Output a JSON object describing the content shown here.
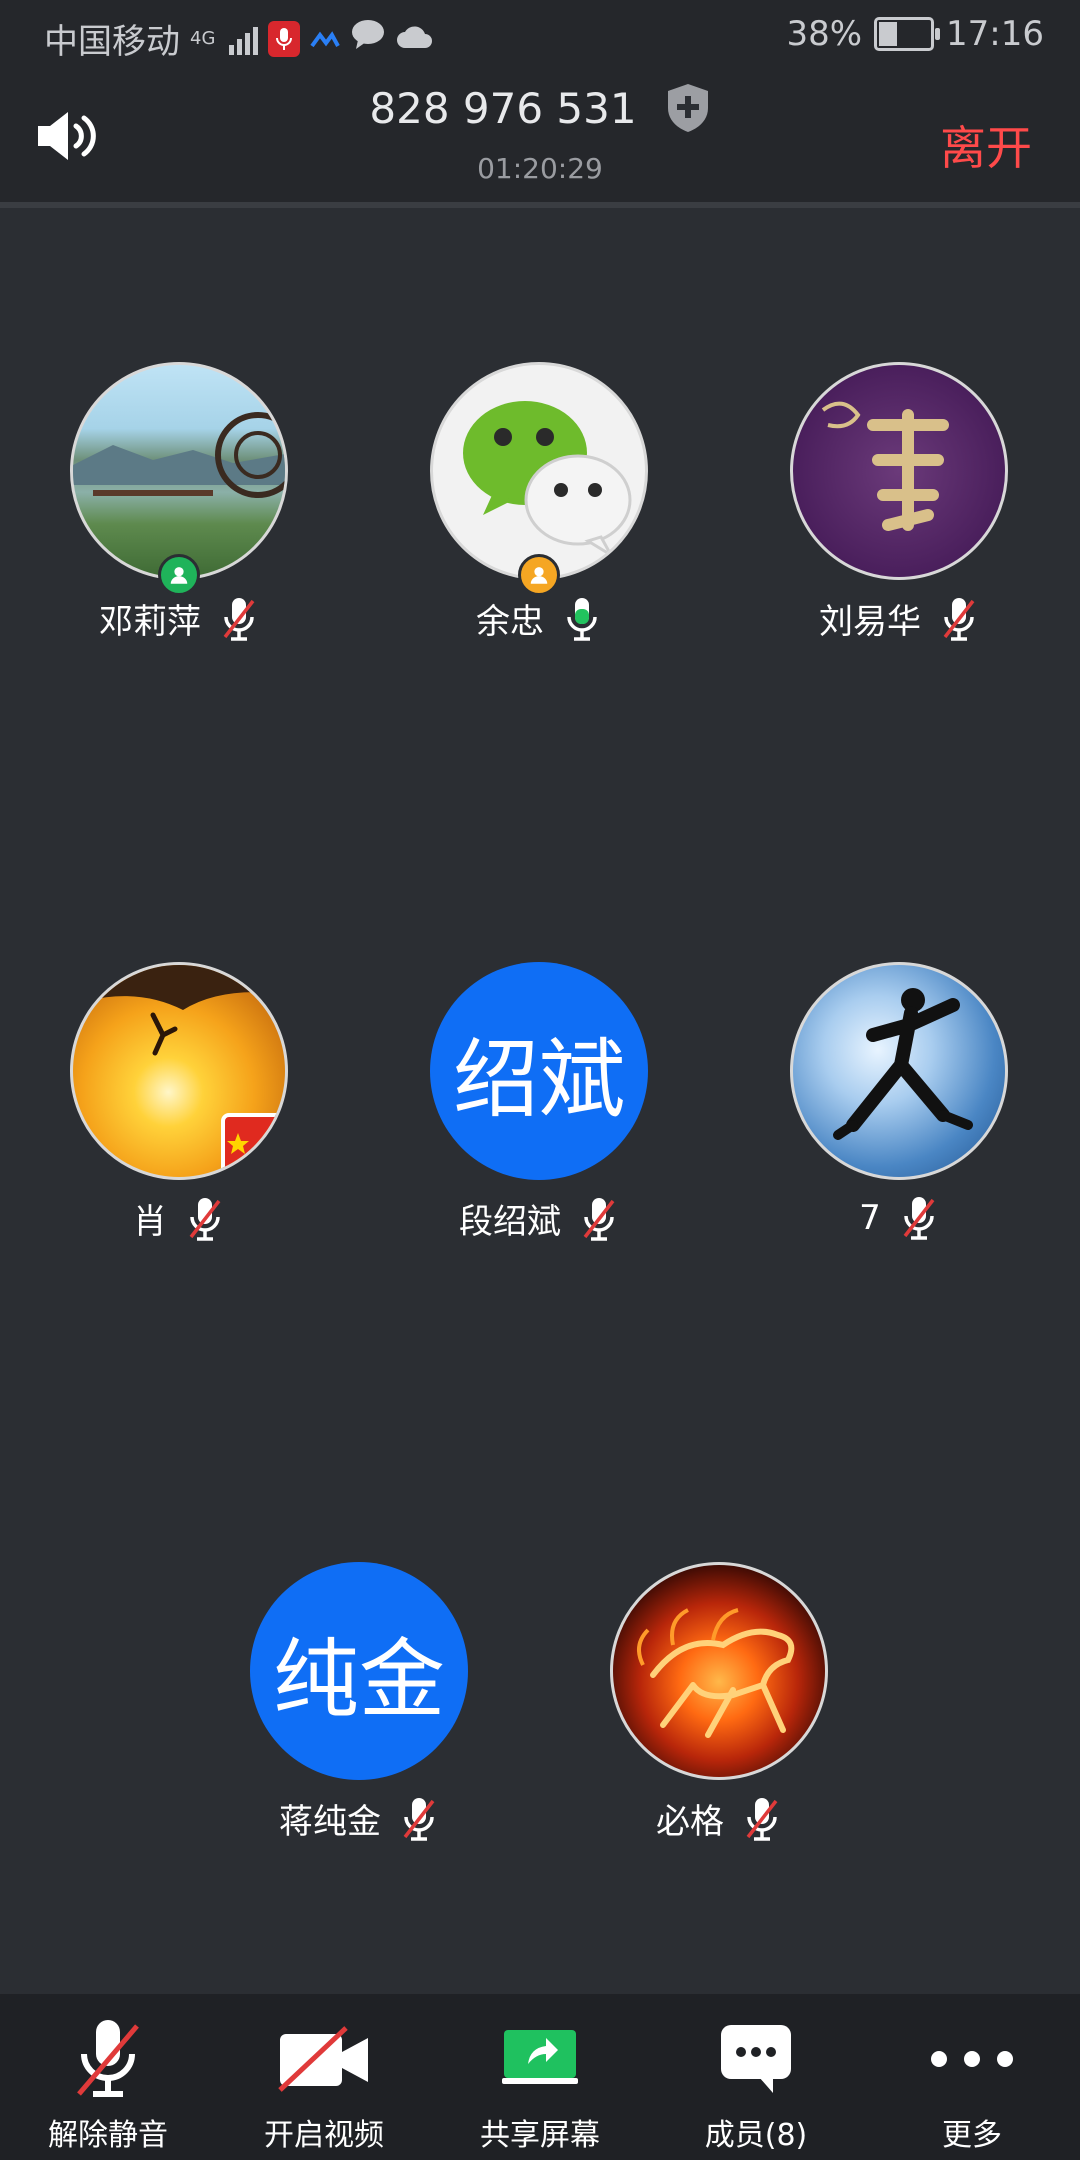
{
  "status_bar": {
    "carrier": "中国移动",
    "network": "4G",
    "battery": "38%",
    "battery_level": 0.38,
    "time": "17:16"
  },
  "header": {
    "meeting_id": "828 976 531",
    "duration": "01:20:29",
    "leave_label": "离开"
  },
  "participants": [
    {
      "name": "邓莉萍",
      "avatar": "photo-landscape",
      "badge": "user-green",
      "mic": "muted"
    },
    {
      "name": "余忠",
      "avatar": "wechat-logo",
      "badge": "user-orange",
      "mic": "active"
    },
    {
      "name": "刘易华",
      "avatar": "purple-calligraphy",
      "mic": "muted"
    },
    {
      "name": "肖",
      "avatar": "photo-sunset",
      "mic": "muted"
    },
    {
      "name": "段绍斌",
      "initials": "绍斌",
      "mic": "muted"
    },
    {
      "name": "7",
      "avatar": "photo-jumpman",
      "mic": "muted"
    },
    {
      "name": "蒋纯金",
      "initials": "纯金",
      "mic": "muted"
    },
    {
      "name": "必格",
      "avatar": "photo-fire-horse",
      "mic": "muted"
    }
  ],
  "toolbar": {
    "unmute": "解除静音",
    "video": "开启视频",
    "share": "共享屏幕",
    "members": "成员(8)",
    "more": "更多"
  },
  "colors": {
    "background": "#2b2e33",
    "leave": "#ff4a4a",
    "initials_bg": "#0f6ef5",
    "share_green": "#1fc15f",
    "muted_red": "#e03a3a",
    "active_green": "#22c35e"
  }
}
